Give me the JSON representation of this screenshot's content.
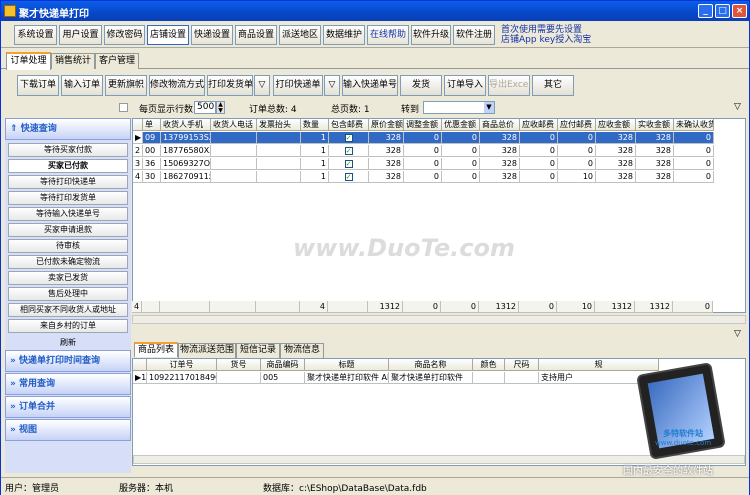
{
  "window": {
    "title": "聚才快递单打印"
  },
  "title_buttons": [
    "_",
    "□",
    "×"
  ],
  "menu": [
    {
      "label": "系统设置",
      "active": false
    },
    {
      "label": "用户设置",
      "active": false
    },
    {
      "label": "修改密码",
      "active": false
    },
    {
      "label": "店铺设置",
      "active": true
    },
    {
      "label": "快递设置",
      "active": false
    },
    {
      "label": "商品设置",
      "active": false
    },
    {
      "label": "派送地区",
      "active": false
    },
    {
      "label": "数据维护",
      "active": false
    },
    {
      "label": "在线帮助",
      "active": false
    },
    {
      "label": "软件升级",
      "active": false
    },
    {
      "label": "软件注册",
      "active": false
    }
  ],
  "notice": {
    "line1": "首次使用需要先设置",
    "line2": "店铺App key授入淘宝"
  },
  "tabs": [
    "订单处理",
    "销售统计",
    "客户管理"
  ],
  "toolbar": [
    "下载订单",
    "输入订单",
    "更新旗帜",
    "修改物流方式",
    "打印发货单",
    "▽",
    "打印快递单",
    "▽",
    "输入快递单号",
    "发货",
    "订单导入",
    "导出Excel",
    "其它"
  ],
  "infobar": {
    "per_page_label": "每页显示行数",
    "per_page_value": "500",
    "total_orders": "订单总数: 4",
    "total_pages": "总页数: 1",
    "goto_label": "转到"
  },
  "sidebar": {
    "quick_query": "快速查询",
    "items": [
      "等待买家付款",
      "买家已付款",
      "等待打印快递单",
      "等待打印发货单",
      "等待输入快递单号",
      "买家申请退款",
      "待审核",
      "已付款未确定物流",
      "卖家已发货",
      "售后处理中",
      "相同买家不同收货人或地址",
      "来自乡村的订单",
      "刷新"
    ],
    "selected": "买家已付款",
    "sections": [
      "快递单打印时间查询",
      "常用查询",
      "订单合并",
      "视图"
    ]
  },
  "orders": {
    "columns": [
      "单",
      "收货人手机",
      "收货人电话",
      "发票抬头",
      "数量",
      "包含邮费",
      "原价金额",
      "调整金额",
      "优惠金额",
      "商品总价",
      "应收邮费",
      "应付邮费",
      "应收金额",
      "实收金额",
      "未确认收货"
    ],
    "rows": [
      {
        "idx": "1",
        "id": "09",
        "phone": "13799153SX",
        "tel": "",
        "invoice": "",
        "qty": "1",
        "post": "✓",
        "orig": "328",
        "adj": "0",
        "disc": "0",
        "total": "328",
        "rpost": "0",
        "ppost": "0",
        "recv": "328",
        "paid": "328",
        "unconf": "0"
      },
      {
        "idx": "2",
        "id": "00",
        "phone": "18776580XX",
        "tel": "",
        "invoice": "",
        "qty": "1",
        "post": "✓",
        "orig": "328",
        "adj": "0",
        "disc": "0",
        "total": "328",
        "rpost": "0",
        "ppost": "0",
        "recv": "328",
        "paid": "328",
        "unconf": "0"
      },
      {
        "idx": "3",
        "id": "36",
        "phone": "15069327OX",
        "tel": "",
        "invoice": "",
        "qty": "1",
        "post": "✓",
        "orig": "328",
        "adj": "0",
        "disc": "0",
        "total": "328",
        "rpost": "0",
        "ppost": "0",
        "recv": "328",
        "paid": "328",
        "unconf": "0"
      },
      {
        "idx": "4",
        "id": "30",
        "phone": "186270911x",
        "tel": "",
        "invoice": "",
        "qty": "1",
        "post": "✓",
        "orig": "328",
        "adj": "0",
        "disc": "0",
        "total": "328",
        "rpost": "0",
        "ppost": "10",
        "recv": "328",
        "paid": "328",
        "unconf": "0"
      }
    ],
    "summary": {
      "idx": "4",
      "qty": "4",
      "orig": "1312",
      "adj": "0",
      "disc": "0",
      "total": "1312",
      "rpost": "0",
      "ppost": "10",
      "recv": "1312",
      "paid": "1312",
      "unconf": "0"
    }
  },
  "watermark": "www.DuoTe.com",
  "bottom_tabs": [
    "商品列表",
    "物流派送范围",
    "短信记录",
    "物流信息"
  ],
  "items": {
    "columns": [
      "订单号",
      "货号",
      "商品编码",
      "标题",
      "商品名称",
      "颜色",
      "尺码",
      "规"
    ],
    "row": {
      "idx": "1",
      "order": "1092211701849O4",
      "sku": "",
      "code": "005",
      "title": "聚才快递单打印软件 API下载 发",
      "name": "聚才快递单打印软件",
      "color": "",
      "size": "",
      "spec": "支持用户"
    }
  },
  "status": {
    "user": "用户：管理员",
    "server": "服务器：本机",
    "db": "数据库：c:\\EShop\\DataBase\\Data.fdb"
  },
  "logo_text": {
    "line1": "多特软件站",
    "line2": "www.duote.com",
    "line3": "国内最安全的软件站"
  }
}
